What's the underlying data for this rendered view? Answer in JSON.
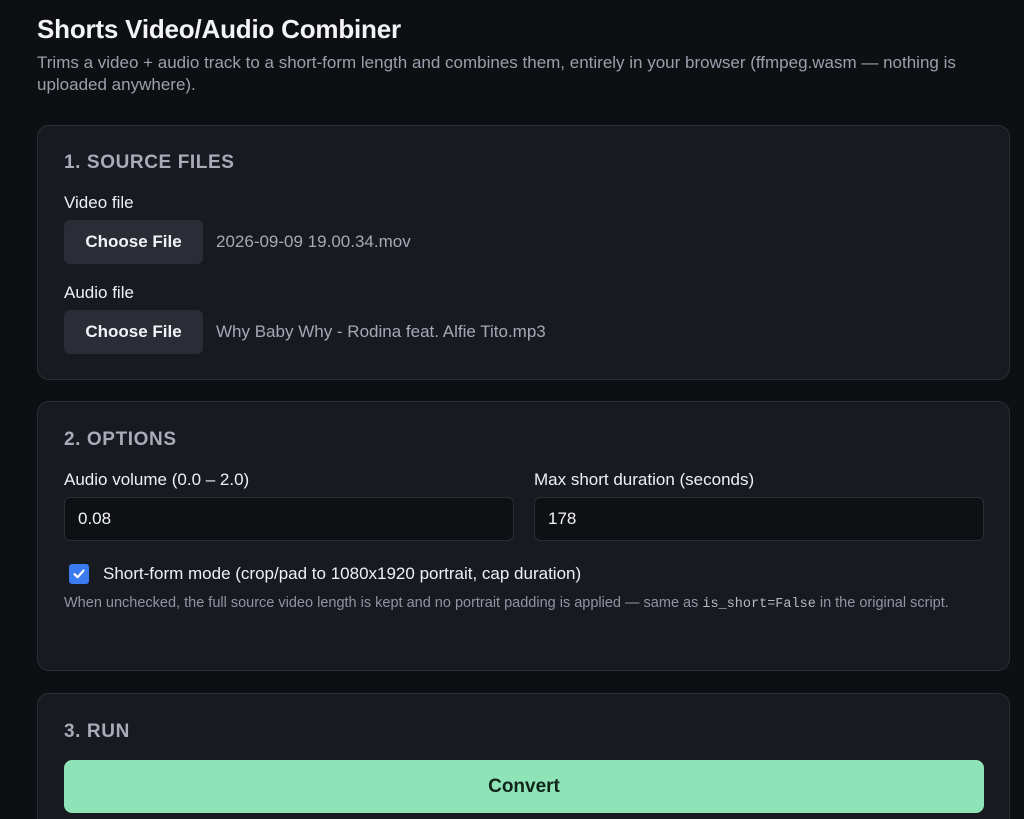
{
  "header": {
    "title": "Shorts Video/Audio Combiner",
    "subtitle": "Trims a video + audio track to a short-form length and combines them, entirely in your browser (ffmpeg.wasm — nothing is uploaded anywhere)."
  },
  "source": {
    "heading": "1. SOURCE FILES",
    "video_label": "Video file",
    "video_button": "Choose File",
    "video_filename": "2026-09-09 19.00.34.mov",
    "audio_label": "Audio file",
    "audio_button": "Choose File",
    "audio_filename": "Why Baby Why - Rodina feat. Alfie Tito.mp3"
  },
  "options": {
    "heading": "2. OPTIONS",
    "volume_label": "Audio volume (0.0 – 2.0)",
    "volume_value": "0.08",
    "duration_label": "Max short duration (seconds)",
    "duration_value": "178",
    "shortform_label": "Short-form mode (crop/pad to 1080x1920 portrait, cap duration)",
    "shortform_checked": true,
    "help_before": "When unchecked, the full source video length is kept and no portrait padding is applied — same as ",
    "help_code": "is_short=False",
    "help_after": " in the original script."
  },
  "run": {
    "heading": "3. RUN",
    "convert_label": "Convert"
  },
  "colors": {
    "accent": "#8ee4b7",
    "checkbox": "#3a7bf0",
    "background": "#0e0f13",
    "card": "#181a21"
  }
}
